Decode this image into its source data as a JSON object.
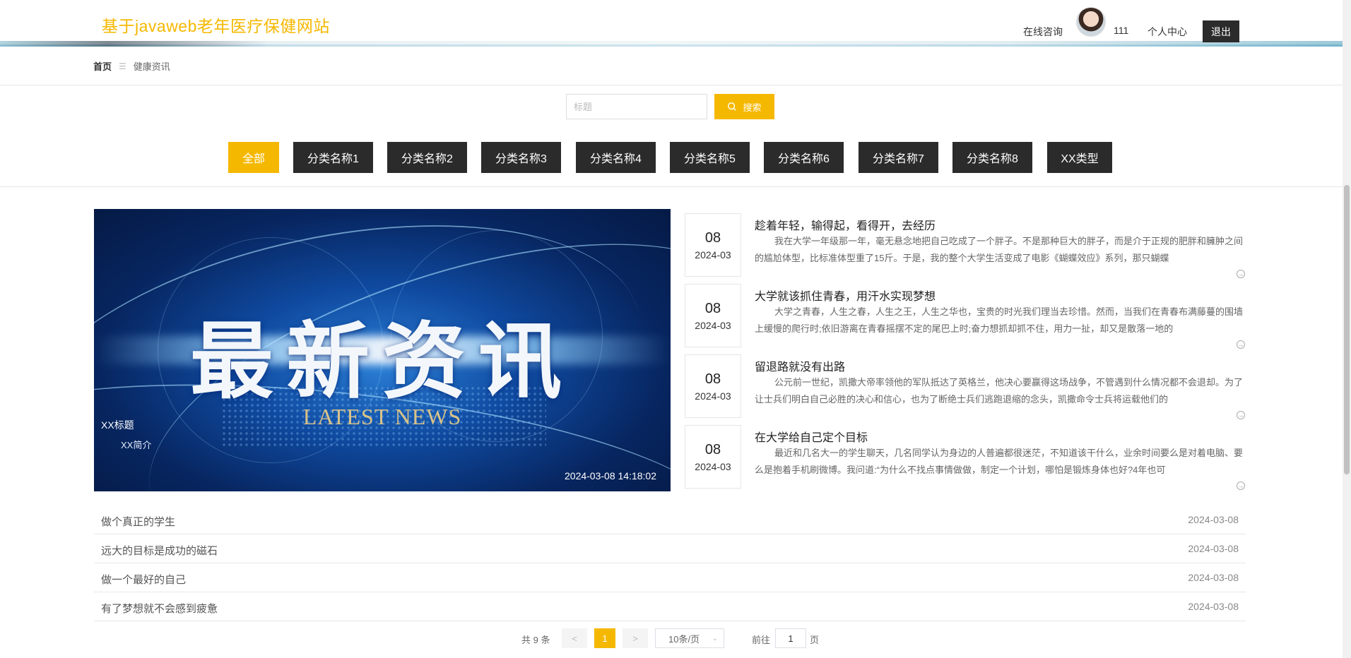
{
  "header": {
    "site_title": "基于javaweb老年医疗保健网站",
    "consult": "在线咨询",
    "username": "111",
    "profile": "个人中心",
    "logout": "退出"
  },
  "breadcrumb": {
    "home": "首页",
    "sep": "☰",
    "current": "健康资讯"
  },
  "search": {
    "placeholder": "标题",
    "button": "搜索"
  },
  "categories": [
    "全部",
    "分类名称1",
    "分类名称2",
    "分类名称3",
    "分类名称4",
    "分类名称5",
    "分类名称6",
    "分类名称7",
    "分类名称8",
    "XX类型"
  ],
  "banner": {
    "big_text": "最新资讯",
    "sub_text": "LATEST NEWS",
    "title": "XX标题",
    "subtitle": "XX简介",
    "time": "2024-03-08 14:18:02"
  },
  "articles": [
    {
      "day": "08",
      "ym": "2024-03",
      "title": "趁着年轻，输得起，看得开，去经历",
      "body": "我在大学一年级那一年，毫无悬念地把自己吃成了一个胖子。不是那种巨大的胖子，而是介于正规的肥胖和臃肿之间的尴尬体型，比标准体型重了15斤。于是，我的整个大学生活变成了电影《蝴蝶效应》系列，那只蝴蝶"
    },
    {
      "day": "08",
      "ym": "2024-03",
      "title": "大学就该抓住青春，用汗水实现梦想",
      "body": "大学之青春，人生之春，人生之王，人生之华也，宝贵的时光我们理当去珍惜。然而，当我们在青春布满藤蔓的围墙上缓慢的爬行时;依旧游离在青春摇摆不定的尾巴上时;奋力想抓却抓不住，用力一扯，却又是散落一地的"
    },
    {
      "day": "08",
      "ym": "2024-03",
      "title": "留退路就没有出路",
      "body": "公元前一世纪，凯撒大帝率领他的军队抵达了英格兰，他决心要赢得这场战争，不管遇到什么情况都不会退却。为了让士兵们明白自己必胜的决心和信心，也为了断绝士兵们逃跑退缩的念头，凯撒命令士兵将运载他们的"
    },
    {
      "day": "08",
      "ym": "2024-03",
      "title": "在大学给自己定个目标",
      "body": "最近和几名大一的学生聊天，几名同学认为身边的人普遍都很迷茫，不知道该干什么，业余时间要么是对着电脑、要么是抱着手机刷微博。我问道:“为什么不找点事情做做，制定一个计划，哪怕是锻炼身体也好?4年也可"
    }
  ],
  "list": [
    {
      "title": "做个真正的学生",
      "date": "2024-03-08"
    },
    {
      "title": "远大的目标是成功的磁石",
      "date": "2024-03-08"
    },
    {
      "title": "做一个最好的自己",
      "date": "2024-03-08"
    },
    {
      "title": "有了梦想就不会感到疲惫",
      "date": "2024-03-08"
    }
  ],
  "pagination": {
    "total": "共 9 条",
    "prev": "<",
    "page": "1",
    "next": ">",
    "page_size": "10条/页",
    "goto_prefix": "前往",
    "goto_value": "1",
    "goto_suffix": "页"
  },
  "colors": {
    "accent": "#f5b800",
    "dark": "#2b2b2b"
  }
}
